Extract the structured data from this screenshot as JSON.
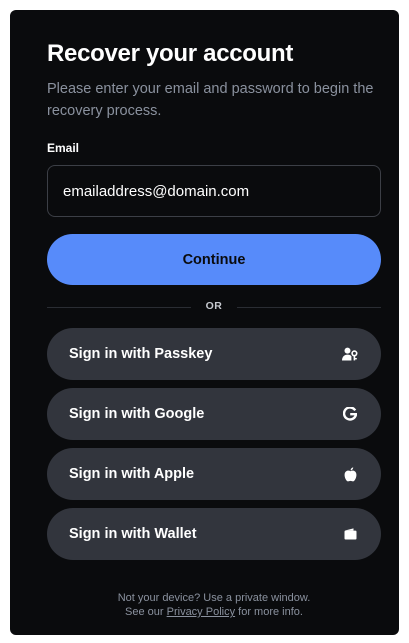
{
  "title": "Recover your account",
  "subtitle": "Please enter your email and password to begin the recovery process.",
  "email": {
    "label": "Email",
    "value": "emailaddress@domain.com"
  },
  "continue_label": "Continue",
  "divider_label": "OR",
  "sign_in_options": [
    {
      "label": "Sign in with Passkey",
      "icon": "passkey-icon"
    },
    {
      "label": "Sign in with Google",
      "icon": "google-icon"
    },
    {
      "label": "Sign in with Apple",
      "icon": "apple-icon"
    },
    {
      "label": "Sign in with Wallet",
      "icon": "wallet-icon"
    }
  ],
  "footer": {
    "line1": "Not your device? Use a private window.",
    "prefix": "See our",
    "link": "Privacy Policy",
    "suffix": "for more info."
  },
  "colors": {
    "background": "#0a0b0d",
    "primary": "#578bfa",
    "secondary_button": "#32353d",
    "muted_text": "#8a919e"
  }
}
